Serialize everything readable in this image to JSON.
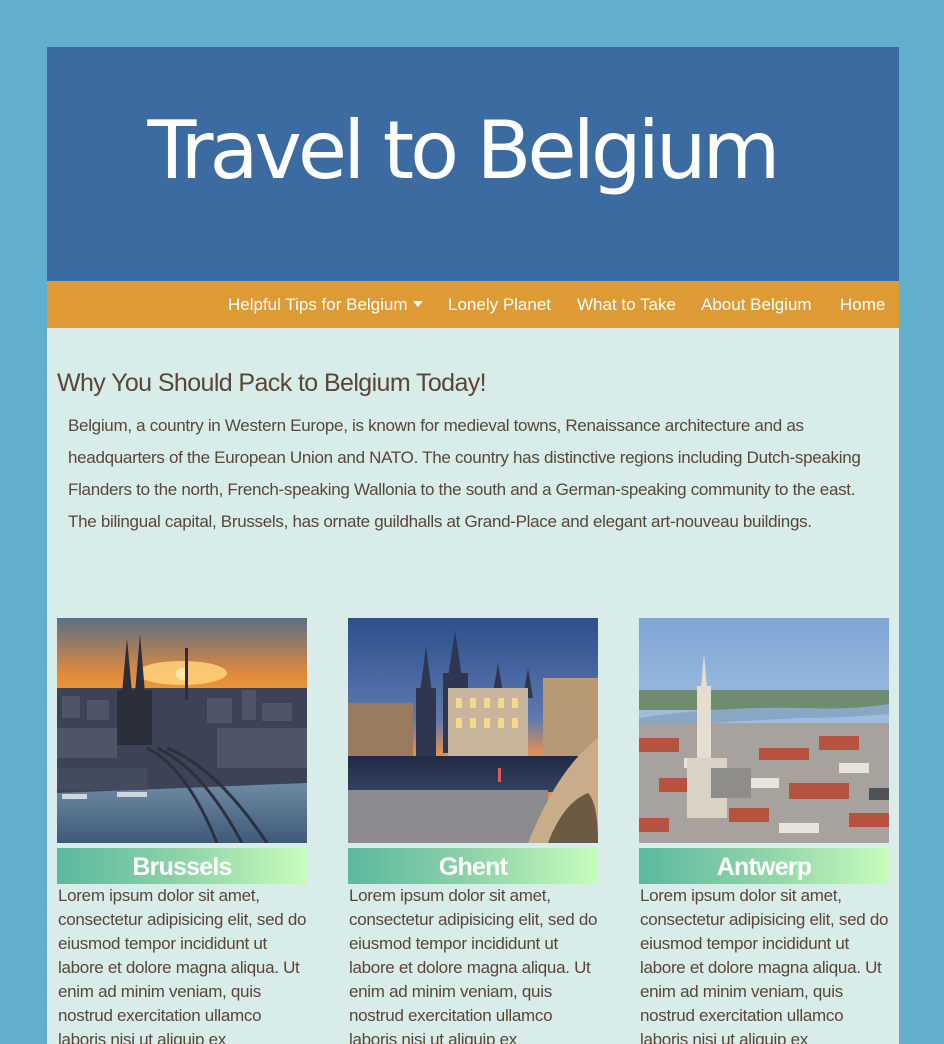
{
  "header": {
    "title": "Travel to Belgium"
  },
  "nav": {
    "items": [
      {
        "label": "Helpful Tips for Belgium",
        "has_dropdown": true
      },
      {
        "label": "Lonely Planet"
      },
      {
        "label": "What to Take"
      },
      {
        "label": "About Belgium"
      },
      {
        "label": "Home"
      }
    ]
  },
  "intro": {
    "heading": "Why You Should Pack to Belgium Today!",
    "body": "Belgium, a country in Western Europe, is known for medieval towns, Renaissance architecture and as headquarters of the European Union and NATO. The country has distinctive regions including Dutch-speaking Flanders to the north, French-speaking Wallonia to the south and a German-speaking community to the east. The bilingual capital, Brussels, has ornate guildhalls at Grand-Place and elegant art-nouveau buildings."
  },
  "cities": [
    {
      "name": "Brussels",
      "description": "Lorem ipsum dolor sit amet, consectetur adipisicing elit, sed do eiusmod tempor incididunt ut labore et dolore magna aliqua. Ut enim ad minim veniam, quis nostrud exercitation ullamco laboris nisi ut aliquip ex"
    },
    {
      "name": "Ghent",
      "description": "Lorem ipsum dolor sit amet, consectetur adipisicing elit, sed do eiusmod tempor incididunt ut labore et dolore magna aliqua. Ut enim ad minim veniam, quis nostrud exercitation ullamco laboris nisi ut aliquip ex"
    },
    {
      "name": "Antwerp",
      "description": "Lorem ipsum dolor sit amet, consectetur adipisicing elit, sed do eiusmod tempor incididunt ut labore et dolore magna aliqua. Ut enim ad minim veniam, quis nostrud exercitation ullamco laboris nisi ut aliquip ex"
    }
  ],
  "colors": {
    "outer_background": "#62afcd",
    "page_background": "#d8ecea",
    "banner": "#3b6ba0",
    "navbar": "#de9a35",
    "body_text": "#5a4637",
    "card_title_gradient_start": "#5ab99f",
    "card_title_gradient_end": "#c6fdbc"
  }
}
